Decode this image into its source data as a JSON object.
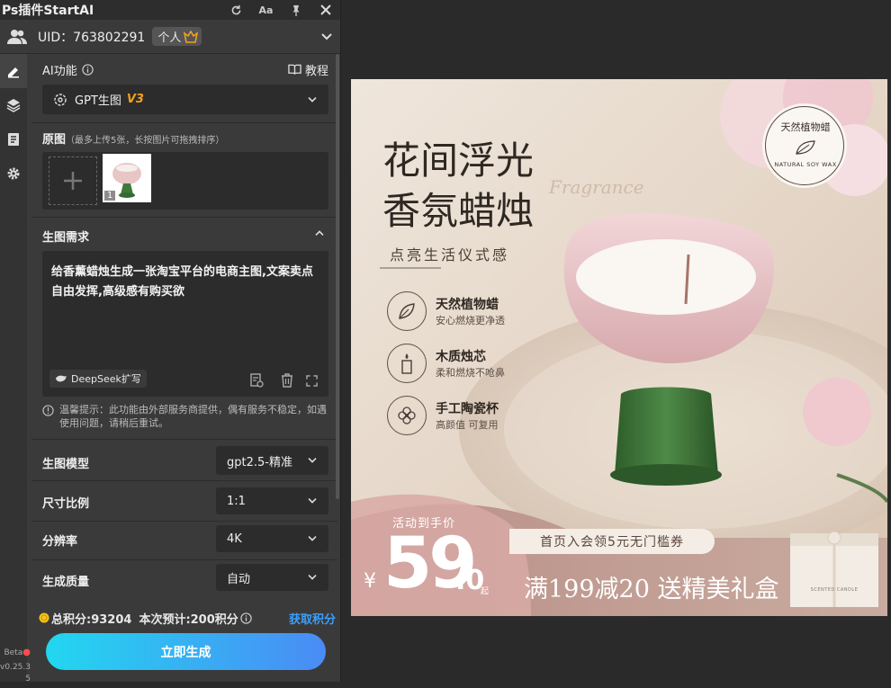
{
  "app": {
    "title": "Ps插件StartAI"
  },
  "user": {
    "uid_label": "UID：763802291",
    "plan": "个人"
  },
  "ai": {
    "label": "AI功能",
    "tutorial": "教程",
    "model_select": "GPT生图",
    "model_version": "V3"
  },
  "source": {
    "label": "原图",
    "hint": "（最多上传5张，长按图片可拖拽排序）",
    "thumb_index": "1"
  },
  "requirement": {
    "label": "生图需求",
    "text": "给香薰蜡烛生成一张淘宝平台的电商主图,文案卖点自由发挥,高级感有购买欲",
    "expand_btn": "DeepSeek扩写"
  },
  "notice": {
    "text": "温馨提示：此功能由外部服务商提供，偶有服务不稳定，如遇使用问题，请稍后重试。"
  },
  "settings": [
    {
      "label": "生图模型",
      "value": "gpt2.5-精准"
    },
    {
      "label": "尺寸比例",
      "value": "1:1"
    },
    {
      "label": "分辨率",
      "value": "4K"
    },
    {
      "label": "生成质量",
      "value": "自动"
    }
  ],
  "points": {
    "total": "总积分:93204",
    "estimate": "本次预计:200积分",
    "get": "获取积分"
  },
  "generate": {
    "label": "立即生成"
  },
  "version": {
    "beta": "Beta",
    "num": "v0.25.3",
    "sub": "5"
  },
  "poster": {
    "title1": "花间浮光",
    "title2": "香氛蜡烛",
    "script": "Fragrance",
    "subtitle": "点亮生活仪式感",
    "seal_cn": "天然植物蜡",
    "seal_en": "NATURAL SOY WAX",
    "features": [
      {
        "title": "天然植物蜡",
        "desc": "安心燃烧更净透",
        "icon": "leaf-icon"
      },
      {
        "title": "木质烛芯",
        "desc": "柔和燃烧不呛鼻",
        "icon": "candle-icon"
      },
      {
        "title": "手工陶瓷杯",
        "desc": "高颜值 可复用",
        "icon": "flower-icon"
      }
    ],
    "price_tag": "活动到手价",
    "currency": "¥",
    "price_int": "59",
    "price_dec": ".0",
    "price_suffix": "起",
    "coupon": "首页入会领5元无门槛券",
    "promo": "满199减20 送精美礼盒",
    "box_text": "SCENTED CANDLE"
  },
  "colors": {
    "accent_gradient_start": "#22d7f0",
    "accent_gradient_end": "#4a8bf5",
    "link": "#3aa0ff",
    "version_orange": "#f0a020"
  }
}
